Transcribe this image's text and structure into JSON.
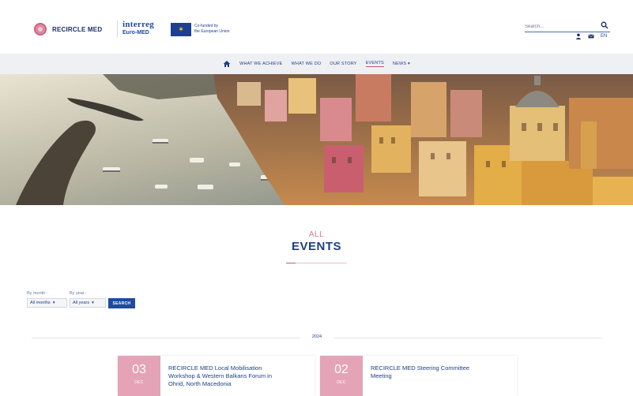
{
  "header": {
    "brand": "RECIRCLE MED",
    "interreg_title": "interreg",
    "interreg_sub": "Euro-MED",
    "eu_line1": "Co-funded by",
    "eu_line2": "the European Union",
    "search_placeholder": "Search...",
    "language": "EN"
  },
  "nav": {
    "items": [
      "WHAT WE ACHIEVE",
      "WHAT WE DO",
      "OUR STORY",
      "EVENTS",
      "NEWS"
    ],
    "active": "EVENTS",
    "news_caret": "▾"
  },
  "page_title": {
    "top": "ALL",
    "main": "EVENTS"
  },
  "filters": {
    "month_label": "By month :",
    "year_label": "By year :",
    "month_value": "All months",
    "year_value": "All years",
    "caret": "▾",
    "search_button": "SEARCH"
  },
  "year_divider": "2024",
  "events": [
    {
      "day": "03",
      "month": "DEC",
      "title_line1": "RECIRCLE MED Local Mobilisation",
      "title_line2": "Workshop & Western Balkans Forum in",
      "title_line3": "Ohrid, North Macedonia"
    },
    {
      "day": "02",
      "month": "DEC",
      "title_line1": "RECIRCLE MED Steering Committee",
      "title_line2": "Meeting",
      "title_line3": ""
    }
  ],
  "colors": {
    "brand_blue": "#1e3e86",
    "accent_pink": "#c7567a",
    "date_pink": "#e5a3b8",
    "button_blue": "#1f4aa0"
  }
}
